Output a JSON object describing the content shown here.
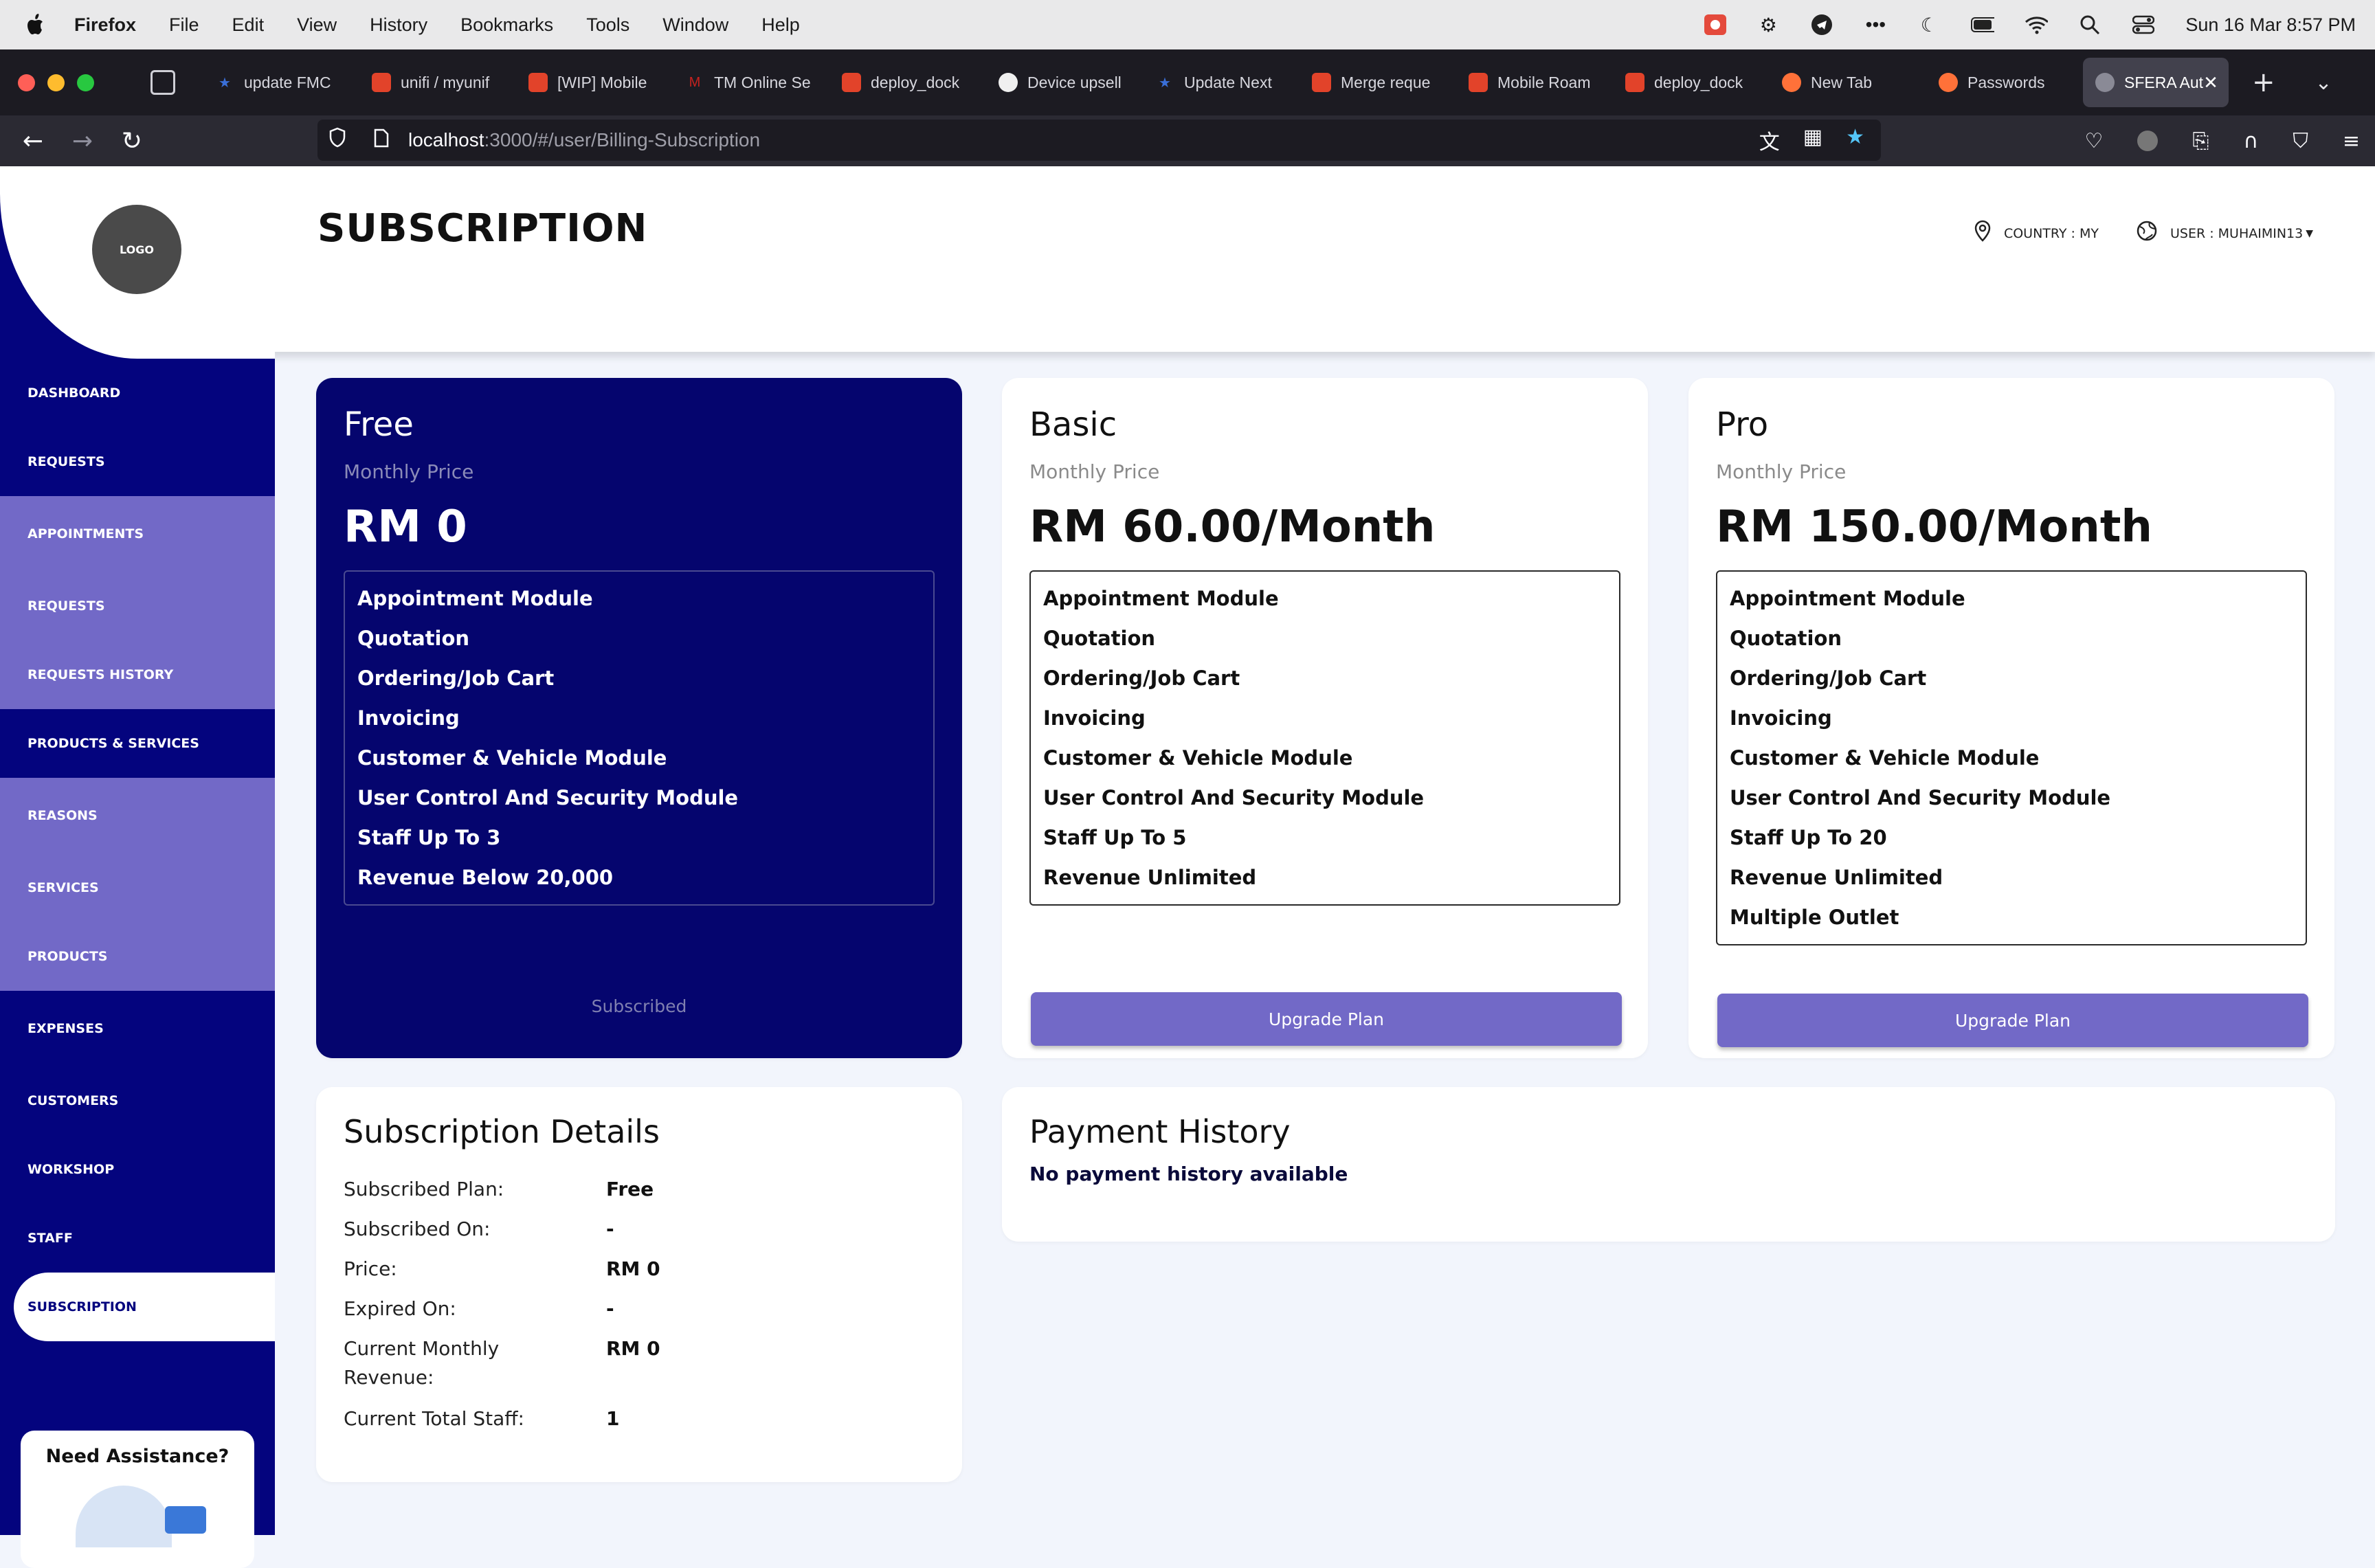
{
  "menubar": {
    "app_name": "Firefox",
    "items": [
      "File",
      "Edit",
      "View",
      "History",
      "Bookmarks",
      "Tools",
      "Window",
      "Help"
    ],
    "clock": "Sun 16 Mar  8:57 PM"
  },
  "browser": {
    "tabs": [
      {
        "label": "update FMC",
        "color": "#3a6fd8"
      },
      {
        "label": "unifi / myunif",
        "color": "#e2432a"
      },
      {
        "label": "[WIP] Mobile",
        "color": "#e2432a"
      },
      {
        "label": "TM Online Se",
        "color": "#c5221f"
      },
      {
        "label": "deploy_dock",
        "color": "#e2432a"
      },
      {
        "label": "Device upsell",
        "color": "#f0f0f0"
      },
      {
        "label": "Update Next",
        "color": "#3a6fd8"
      },
      {
        "label": "Merge reque",
        "color": "#e2432a"
      },
      {
        "label": "Mobile Roam",
        "color": "#e2432a"
      },
      {
        "label": "deploy_dock",
        "color": "#e2432a"
      },
      {
        "label": "New Tab",
        "color": "#ff7139"
      },
      {
        "label": "Passwords",
        "color": "#ff7139"
      }
    ],
    "active_tab": "SFERA Aut",
    "url_host": "localhost",
    "url_path": ":3000/#/user/Billing-Subscription"
  },
  "header": {
    "logo": "LOGO",
    "title": "SUBSCRIPTION",
    "country": "COUNTRY : MY",
    "user": "USER : MUHAIMIN13"
  },
  "sidebar": {
    "items": [
      {
        "label": "DASHBOARD"
      },
      {
        "label": "REQUESTS"
      },
      {
        "label": "APPOINTMENTS"
      },
      {
        "label": "REQUESTS"
      },
      {
        "label": "REQUESTS HISTORY"
      },
      {
        "label": "PRODUCTS & SERVICES"
      },
      {
        "label": "REASONS"
      },
      {
        "label": "SERVICES"
      },
      {
        "label": "PRODUCTS"
      },
      {
        "label": "EXPENSES"
      },
      {
        "label": "CUSTOMERS"
      },
      {
        "label": "WORKSHOP"
      },
      {
        "label": "STAFF"
      },
      {
        "label": "SUBSCRIPTION"
      }
    ],
    "assist_title": "Need Assistance?"
  },
  "plans": {
    "free": {
      "name": "Free",
      "label": "Monthly Price",
      "price": "RM 0",
      "features": [
        "Appointment Module",
        "Quotation",
        "Ordering/Job Cart",
        "Invoicing",
        "Customer & Vehicle Module",
        "User Control And Security Module",
        "Staff Up To 3",
        "Revenue Below 20,000"
      ],
      "status": "Subscribed"
    },
    "basic": {
      "name": "Basic",
      "label": "Monthly Price",
      "price": "RM 60.00/Month",
      "features": [
        "Appointment Module",
        "Quotation",
        "Ordering/Job Cart",
        "Invoicing",
        "Customer & Vehicle Module",
        "User Control And Security Module",
        "Staff Up To 5",
        "Revenue Unlimited"
      ],
      "button": "Upgrade Plan"
    },
    "pro": {
      "name": "Pro",
      "label": "Monthly Price",
      "price": "RM 150.00/Month",
      "features": [
        "Appointment Module",
        "Quotation",
        "Ordering/Job Cart",
        "Invoicing",
        "Customer & Vehicle Module",
        "User Control And Security Module",
        "Staff Up To 20",
        "Revenue Unlimited",
        "Multiple Outlet"
      ],
      "button": "Upgrade Plan"
    }
  },
  "details": {
    "title": "Subscription Details",
    "rows": [
      {
        "k": "Subscribed Plan:",
        "v": "Free"
      },
      {
        "k": "Subscribed On:",
        "v": "-"
      },
      {
        "k": "Price:",
        "v": "RM 0"
      },
      {
        "k": "Expired On:",
        "v": "-"
      },
      {
        "k": "Current Monthly Revenue:",
        "v": "RM 0"
      },
      {
        "k": "Current Total Staff:",
        "v": "1"
      }
    ]
  },
  "history": {
    "title": "Payment History",
    "empty": "No payment history available"
  }
}
